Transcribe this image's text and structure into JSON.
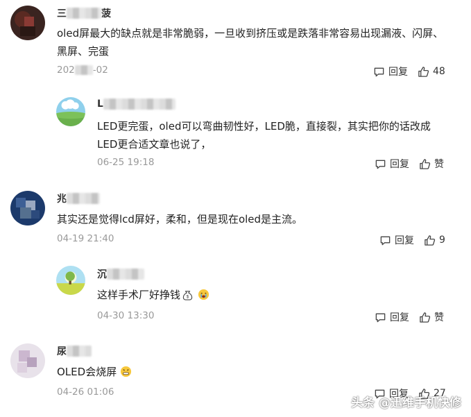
{
  "comments": [
    {
      "author_visible": "三",
      "author_suffix": "菠",
      "text": "oled屏最大的缺点就是非常脆弱，一旦收到挤压或是跌落非常容易出现漏液、闪屏、黑屏、完蛋",
      "date_prefix": "202",
      "date_suffix": "-02",
      "reply_label": "回复",
      "like_label": "48"
    },
    {
      "author_visible": "L",
      "text": "LED更完蛋，oled可以弯曲韧性好，LED脆，直接裂，其实把你的话改成LED更合适文章也说了，",
      "date": "06-25 19:18",
      "reply_label": "回复",
      "like_label": "赞"
    },
    {
      "author_visible": "兆",
      "text": "其实还是觉得lcd屏好，柔和，但是现在oled是主流。",
      "date": "04-19 21:40",
      "reply_label": "回复",
      "like_label": "9"
    },
    {
      "author_visible": "沉",
      "text": "这样手术厂好挣钱",
      "date": "04-30 13:30",
      "reply_label": "回复",
      "like_label": "赞"
    },
    {
      "author_visible": "尿",
      "text": "OLED会烧屏",
      "date": "04-26 01:06",
      "reply_label": "回复",
      "like_label": "27"
    }
  ],
  "watermark": "头条 @迅维手机快修"
}
